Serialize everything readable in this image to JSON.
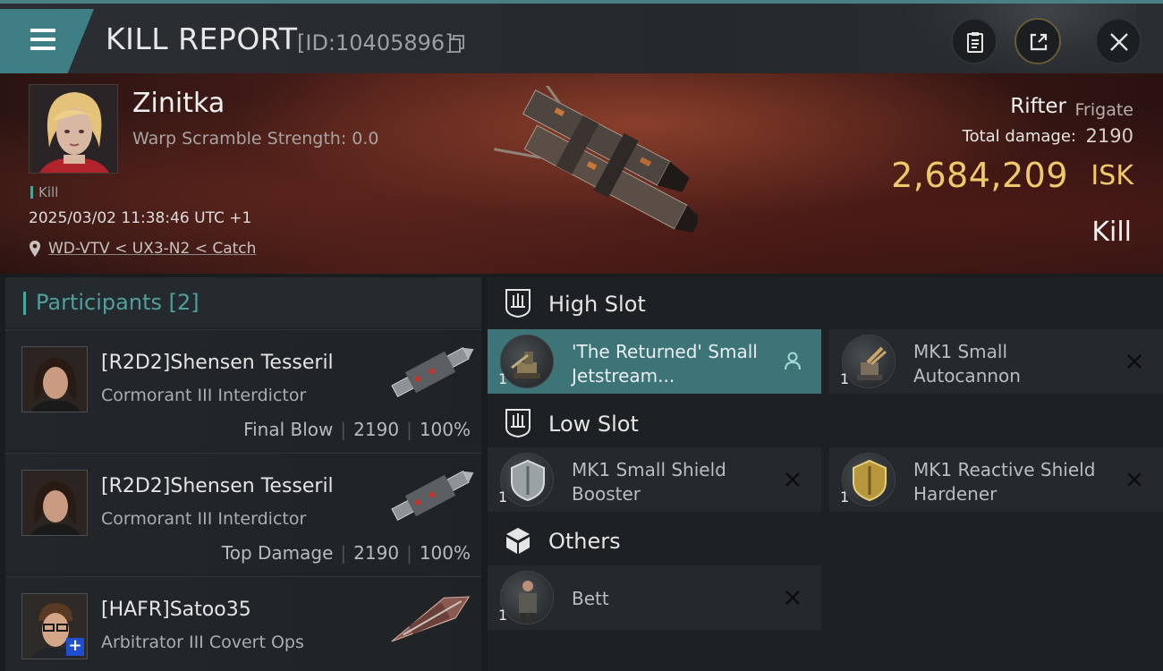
{
  "header": {
    "title": "KILL REPORT",
    "report_id": "[ID:10405896]",
    "icons": [
      "menu-icon",
      "copy-icon",
      "clipboard-icon",
      "share-icon",
      "close-icon"
    ]
  },
  "victim": {
    "name": "Zinitka",
    "warp_scramble": "Warp Scramble Strength: 0.0",
    "kill_tag": "Kill",
    "timestamp": "2025/03/02 11:38:46 UTC +1",
    "location": "WD-VTV < UX3-N2 < Catch",
    "ship_name": "Rifter",
    "ship_class": "Frigate",
    "total_damage_label": "Total damage:",
    "total_damage": "2190",
    "isk_value": "2,684,209",
    "isk_unit": "ISK",
    "result": "Kill"
  },
  "participants": {
    "title": "Participants [2]",
    "rows": [
      {
        "name": "[R2D2]Shensen Tesseril",
        "ship": "Cormorant III Interdictor",
        "label": "Final Blow",
        "damage": "2190",
        "percent": "100%"
      },
      {
        "name": "[R2D2]Shensen Tesseril",
        "ship": "Cormorant III Interdictor",
        "label": "Top Damage",
        "damage": "2190",
        "percent": "100%"
      },
      {
        "name": "[HAFR]Satoo35",
        "ship": "Arbitrator III Covert Ops"
      }
    ]
  },
  "fitting": {
    "high_slot": {
      "label": "High Slot",
      "items": [
        {
          "qty": "1",
          "name": "'The Returned' Small Jetstream...",
          "state": "person-icon"
        },
        {
          "qty": "1",
          "name": "MK1 Small Autocannon",
          "state": "close-icon"
        }
      ]
    },
    "low_slot": {
      "label": "Low Slot",
      "items": [
        {
          "qty": "1",
          "name": "MK1 Small Shield Booster",
          "state": "close-icon"
        },
        {
          "qty": "1",
          "name": "MK1 Reactive Shield Hardener",
          "state": "close-icon"
        }
      ]
    },
    "others": {
      "label": "Others",
      "items": [
        {
          "qty": "1",
          "name": "Bett",
          "state": "close-icon"
        }
      ]
    }
  },
  "colors": {
    "accent_teal": "#3e7f86",
    "isk_gold": "#f0c96a",
    "active_slot": "#3d7478"
  }
}
